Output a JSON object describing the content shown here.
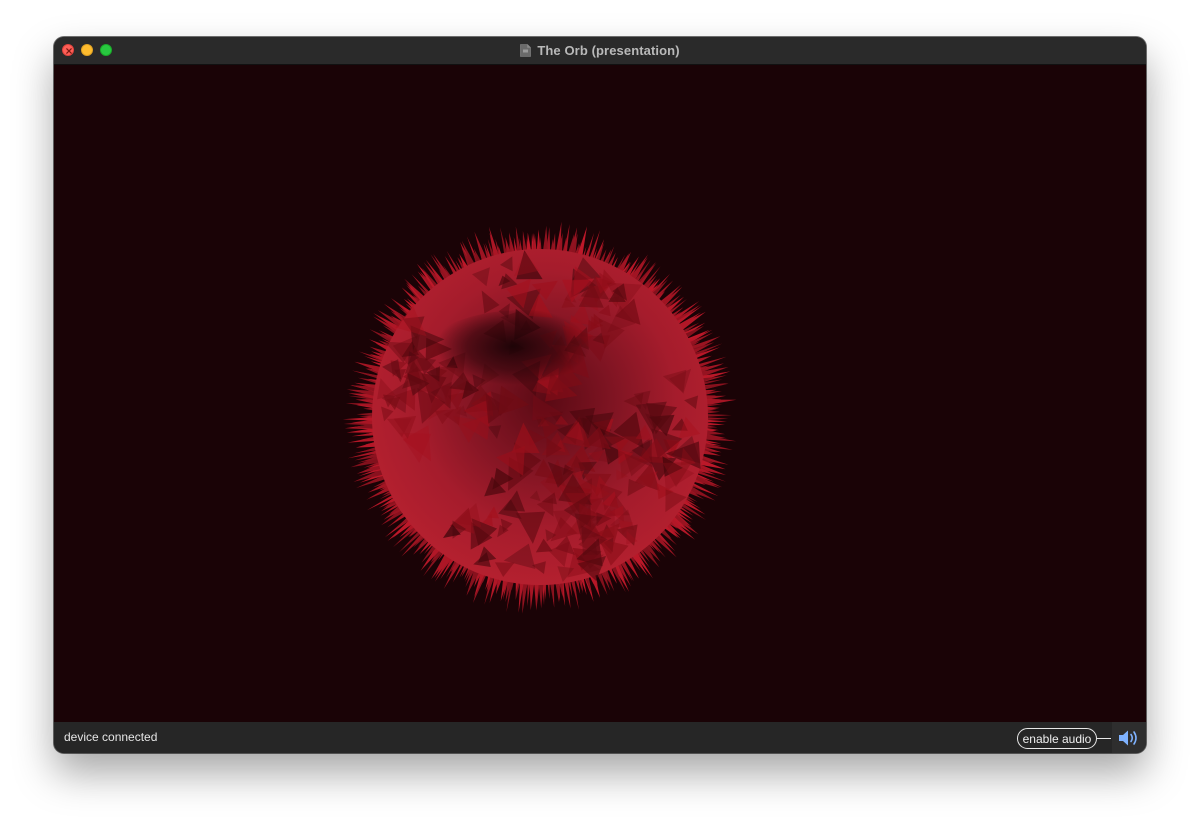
{
  "window": {
    "title": "The Orb (presentation)"
  },
  "visual": {
    "background_color": "#1a0306",
    "orb_color": "#a01a2a"
  },
  "statusbar": {
    "status_text": "device connected",
    "audio_button_label": "enable audio"
  },
  "icons": {
    "document": "document-icon",
    "speaker": "speaker-icon",
    "close": "close-icon"
  }
}
